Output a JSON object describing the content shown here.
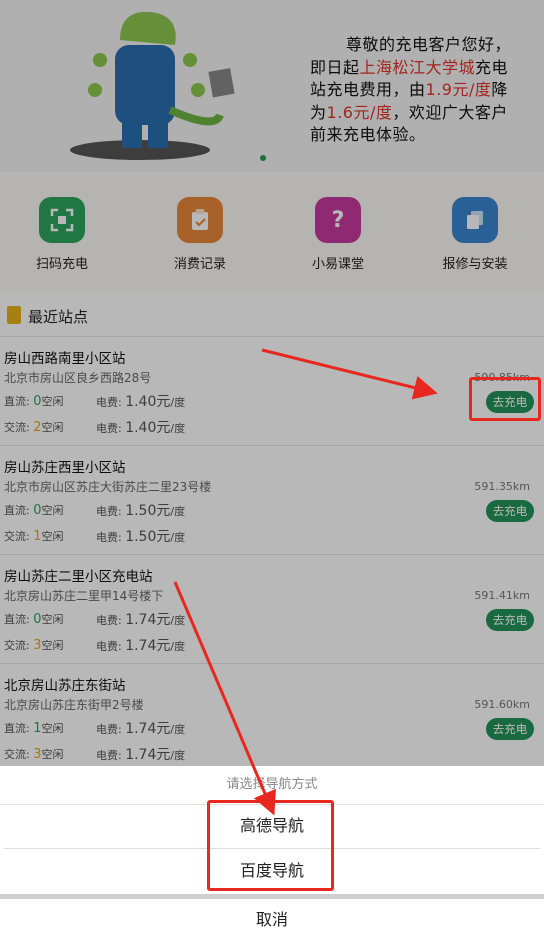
{
  "banner": {
    "line1": "尊敬的充电客户您好，",
    "line2_pre": "即日起",
    "line2_red": "上海松江大学城",
    "line2_post": "充电",
    "line3_pre": "站充电费用，由",
    "line3_red": "1.9元/度",
    "line3_post": "降",
    "line4_pre": "为",
    "line4_red": "1.6元/度",
    "line4_post": "，欢迎广大客户",
    "line5": "前来充电体验。"
  },
  "menu": [
    {
      "label": "扫码充电",
      "icon": "scan-icon",
      "color": "#2fa65f"
    },
    {
      "label": "消费记录",
      "icon": "clipboard-icon",
      "color": "#e8873a"
    },
    {
      "label": "小易课堂",
      "icon": "question-icon",
      "color": "#c63a9e"
    },
    {
      "label": "报修与安装",
      "icon": "copy-icon",
      "color": "#3a86cf"
    }
  ],
  "section": {
    "title": "最近站点",
    "icon": "book-icon"
  },
  "labels": {
    "dc": "直流: ",
    "ac": "交流: ",
    "free": "空闲",
    "fee": "电费: ",
    "unit": "元",
    "per": "/度",
    "go": "去充电"
  },
  "stations": [
    {
      "name": "房山西路南里小区站",
      "address": "北京市房山区良乡西路28号",
      "distance": "590.85km",
      "dc_free": "0",
      "ac_free": "2",
      "dc_price": "1.40",
      "ac_price": "1.40"
    },
    {
      "name": "房山苏庄西里小区站",
      "address": "北京市房山区苏庄大街苏庄二里23号楼",
      "distance": "591.35km",
      "dc_free": "0",
      "ac_free": "1",
      "dc_price": "1.50",
      "ac_price": "1.50"
    },
    {
      "name": "房山苏庄二里小区充电站",
      "address": "北京房山苏庄二里甲14号楼下",
      "distance": "591.41km",
      "dc_free": "0",
      "ac_free": "3",
      "dc_price": "1.74",
      "ac_price": "1.74"
    },
    {
      "name": "北京房山苏庄东街站",
      "address": "北京房山苏庄东街甲2号楼",
      "distance": "591.60km",
      "dc_free": "1",
      "ac_free": "3",
      "dc_price": "1.74",
      "ac_price": "1.74"
    }
  ],
  "sheet": {
    "title": "请选择导航方式",
    "options": [
      "高德导航",
      "百度导航"
    ],
    "cancel": "取消"
  },
  "colors": {
    "accent_green": "#23925a",
    "highlight_red": "#e8281f",
    "price_yellow": "#e7a615"
  }
}
